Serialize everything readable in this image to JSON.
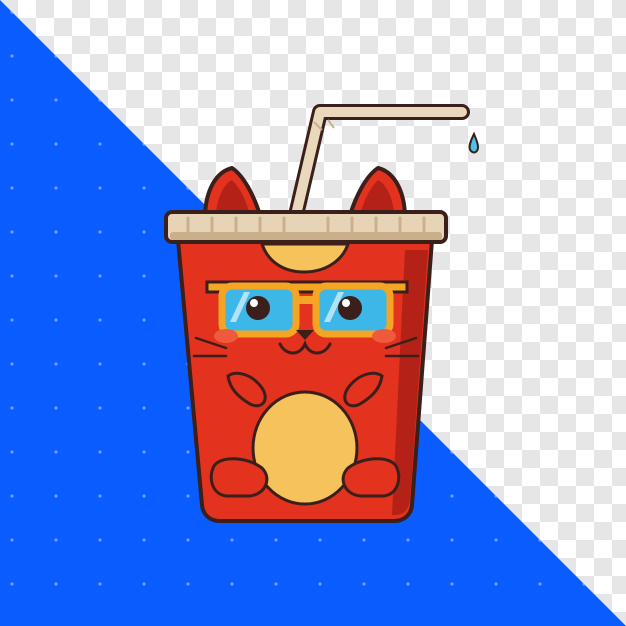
{
  "image": {
    "subject": "cat-shaped-drink-cup-illustration",
    "colors": {
      "checker_light": "#ffffff",
      "checker_dark": "#e6e6e6",
      "blue": "#0b5cff",
      "blue_dot": "#6fa0ff",
      "cup_red": "#e3321e",
      "cup_red_dark": "#b42217",
      "cup_red_light": "#f05a3c",
      "lid": "#e7d3b5",
      "lid_shade": "#c9b08a",
      "straw": "#e9d8bc",
      "belly": "#f5c25c",
      "glasses": "#f5a524",
      "lens": "#3db6e8",
      "outline": "#3b1f1a",
      "drop": "#4cc3ef"
    }
  }
}
